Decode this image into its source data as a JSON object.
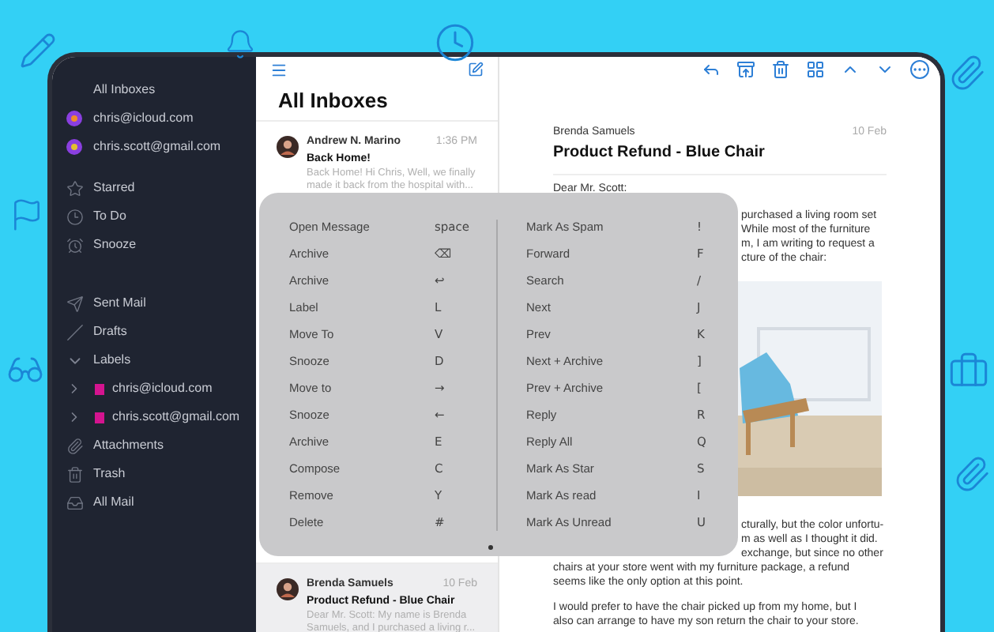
{
  "sidebar": {
    "sections": [
      [
        {
          "label": "All Inboxes",
          "kind": "all"
        },
        {
          "label": "chris@icloud.com",
          "kind": "account",
          "color": "#f28c28"
        },
        {
          "label": "chris.scott@gmail.com",
          "kind": "account",
          "color": "#e3c02f"
        }
      ],
      [
        {
          "label": "Starred",
          "kind": "starred"
        },
        {
          "label": "To Do",
          "kind": "todo"
        },
        {
          "label": "Snooze",
          "kind": "snooze"
        }
      ],
      [
        {
          "label": "Sent Mail",
          "kind": "sent"
        },
        {
          "label": "Drafts",
          "kind": "drafts"
        },
        {
          "label": "Labels",
          "kind": "group",
          "expanded": true,
          "children": [
            {
              "label": "chris@icloud.com",
              "expanded": false
            },
            {
              "label": "chris.scott@gmail.com",
              "expanded": false
            }
          ]
        },
        {
          "label": "Attachments",
          "kind": "attachments"
        },
        {
          "label": "Trash",
          "kind": "trash"
        },
        {
          "label": "All Mail",
          "kind": "allmail"
        }
      ]
    ]
  },
  "message_list": {
    "title": "All Inboxes",
    "messages": [
      {
        "sender": "Andrew N. Marino",
        "time": "1:36 PM",
        "subject": "Back Home!",
        "preview": "Back Home! Hi Chris, Well, we finally made it back from the hospital with...",
        "selected": false
      },
      {
        "sender": "Brenda Samuels",
        "time": "10 Feb",
        "subject": "Product Refund - Blue Chair",
        "preview": "Dear Mr. Scott: My name is Brenda Samuels, and I purchased a living r...",
        "selected": true
      }
    ]
  },
  "reader": {
    "sender": "Brenda Samuels",
    "date": "10 Feb",
    "subject": "Product Refund - Blue Chair",
    "greeting": "Dear Mr. Scott:",
    "covered_lines_1": [
      "purchased a living room set",
      "While most of the furniture",
      "m, I am writing to request a",
      "cture of the chair:"
    ],
    "covered_lines_2": [
      "cturally, but the color unfortu-",
      "m as well as I thought it did.",
      "exchange, but since no other"
    ],
    "lines_2": [
      "chairs at your store went with my furniture package, a refund",
      "seems like the only option at this point."
    ],
    "lines_3": [
      "I would prefer to have the chair picked up from my home, but I",
      "also can arrange to have my son return the chair to your store."
    ]
  },
  "shortcuts": {
    "columns": [
      [
        {
          "action": "Open Message",
          "key": "space"
        },
        {
          "action": "Archive",
          "key": "⌫"
        },
        {
          "action": "Archive",
          "key": "↩"
        },
        {
          "action": "Label",
          "key": "L"
        },
        {
          "action": "Move To",
          "key": "V"
        },
        {
          "action": "Snooze",
          "key": "D"
        },
        {
          "action": "Move to",
          "key": "→"
        },
        {
          "action": "Snooze",
          "key": "←"
        },
        {
          "action": "Archive",
          "key": "E"
        },
        {
          "action": "Compose",
          "key": "C"
        },
        {
          "action": "Remove",
          "key": "Y"
        },
        {
          "action": "Delete",
          "key": "#"
        }
      ],
      [
        {
          "action": "Mark As Spam",
          "key": "!"
        },
        {
          "action": "Forward",
          "key": "F"
        },
        {
          "action": "Search",
          "key": "/"
        },
        {
          "action": "Next",
          "key": "J"
        },
        {
          "action": "Prev",
          "key": "K"
        },
        {
          "action": "Next + Archive",
          "key": "]"
        },
        {
          "action": "Prev + Archive",
          "key": "["
        },
        {
          "action": "Reply",
          "key": "R"
        },
        {
          "action": "Reply All",
          "key": "Q"
        },
        {
          "action": "Mark As Star",
          "key": "S"
        },
        {
          "action": "Mark As read",
          "key": "I"
        },
        {
          "action": "Mark As Unread",
          "key": "U"
        }
      ]
    ]
  }
}
